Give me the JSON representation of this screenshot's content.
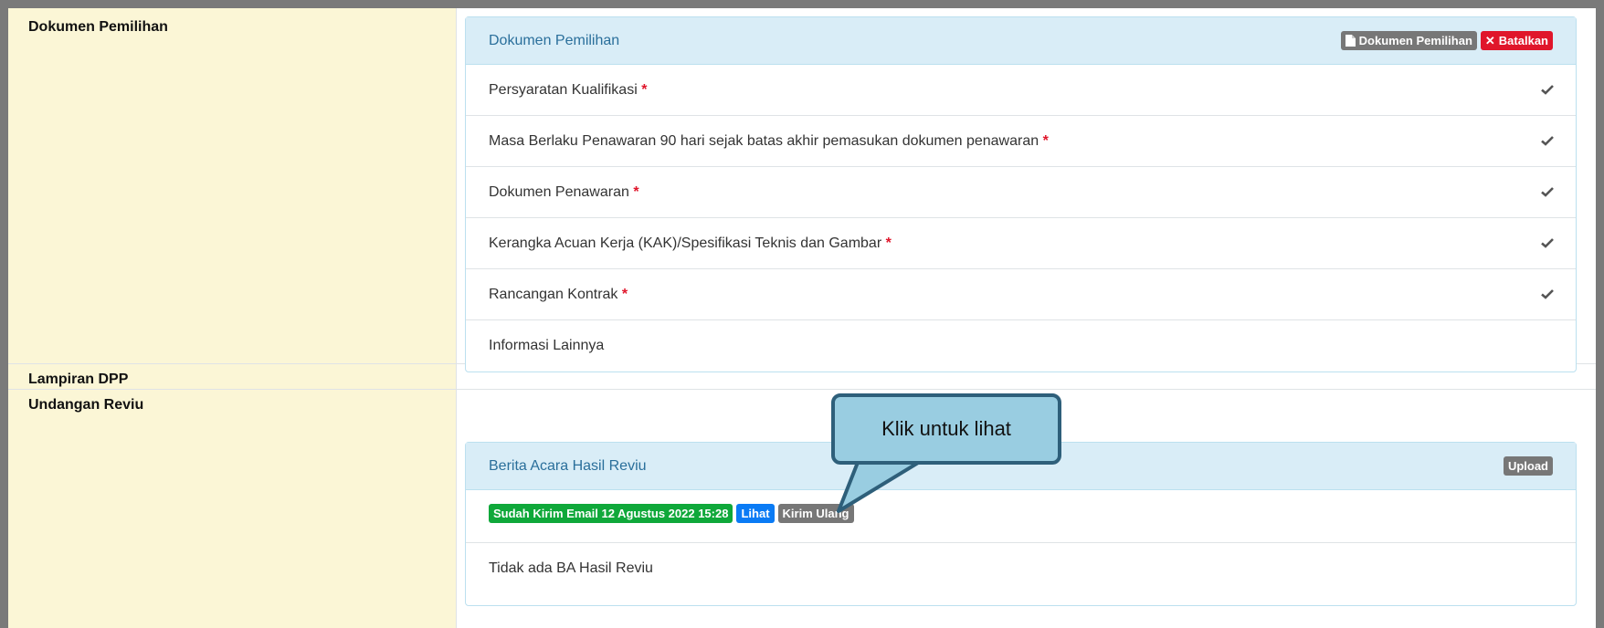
{
  "rows": {
    "dokumen_pemilihan_label": "Dokumen Pemilihan",
    "lampiran_label": "Lampiran DPP",
    "undangan_label": "Undangan Reviu"
  },
  "dokumen_panel": {
    "title": "Dokumen Pemilihan",
    "btn_dokumen": "Dokumen Pemilihan",
    "btn_batalkan": "Batalkan",
    "items": [
      {
        "text": "Persyaratan Kualifikasi",
        "required": "*",
        "checked": true
      },
      {
        "text": "Masa Berlaku Penawaran 90 hari sejak batas akhir pemasukan dokumen penawaran",
        "required": "*",
        "checked": true
      },
      {
        "text": "Dokumen Penawaran",
        "required": "*",
        "checked": true
      },
      {
        "text": "Kerangka Acuan Kerja (KAK)/Spesifikasi Teknis dan Gambar",
        "required": "*",
        "checked": true
      },
      {
        "text": "Rancangan Kontrak",
        "required": "*",
        "checked": true
      },
      {
        "text": "Informasi Lainnya",
        "required": "",
        "checked": false
      }
    ]
  },
  "reviu_panel": {
    "title": "Berita Acara Hasil Reviu",
    "btn_upload": "Upload",
    "status": "Sudah Kirim Email 12 Agustus 2022 15:28",
    "btn_lihat": "Lihat",
    "btn_kirim_ulang": "Kirim Ulang",
    "empty_text": "Tidak ada BA Hasil Reviu"
  },
  "callout": {
    "text": "Klik untuk lihat"
  },
  "colors": {
    "label_bg": "#fbf6d6",
    "panel_head": "#d9edf7",
    "danger": "#e0162b",
    "success": "#0fa83a",
    "primary": "#0a7bf5",
    "default": "#777777",
    "callout_fill": "#99cde1",
    "callout_border": "#2e5f7a"
  },
  "icons": {
    "file": "file-icon",
    "times": "times-icon",
    "check": "check-icon"
  }
}
